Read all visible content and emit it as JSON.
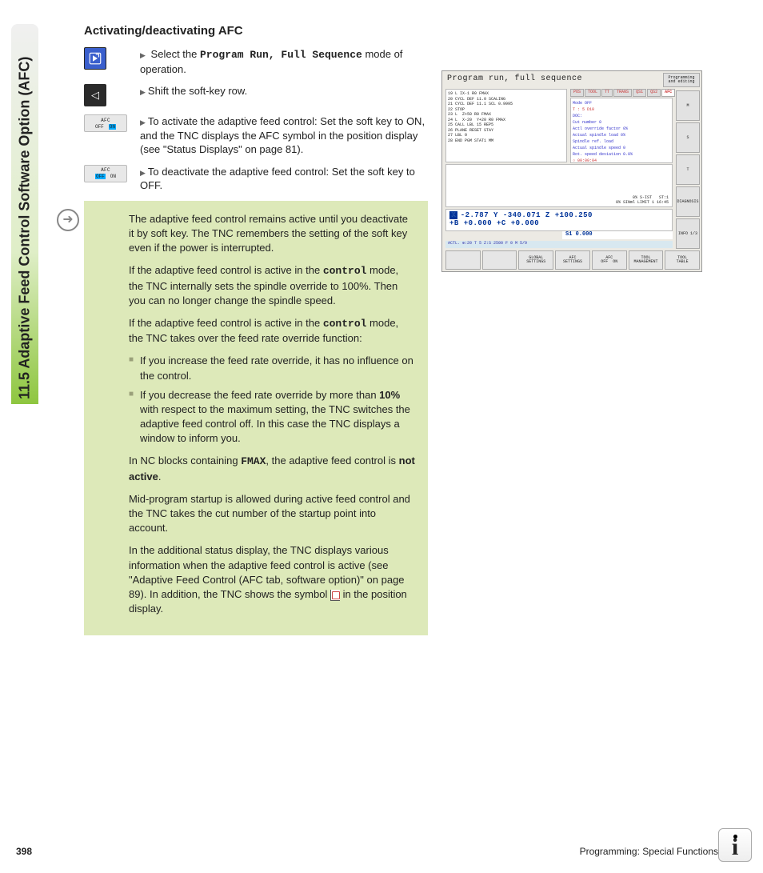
{
  "sidebar": {
    "label": "11.5 Adaptive Feed Control Software Option (AFC)"
  },
  "heading": "Activating/deactivating AFC",
  "steps": {
    "s1a": "Select the ",
    "s1_mono": "Program Run, Full Sequence",
    "s1b": " mode of operation.",
    "s2": "Shift the soft-key row.",
    "s3": "To activate the adaptive feed control: Set the soft key to ON, and the TNC displays the AFC symbol in the position display (see \"Status Displays\" on page 81).",
    "s4": "To deactivate the adaptive feed control: Set the soft key to OFF."
  },
  "softkey": {
    "label": "AFC",
    "off": "OFF",
    "on": "ON"
  },
  "note": {
    "p1": "The adaptive feed control remains active until you deactivate it by soft key. The TNC remembers the setting of the soft key even if the power is interrupted.",
    "p2a": "If the adaptive feed control is active in the ",
    "p2_mono": "control",
    "p2b": " mode, the TNC internally sets the spindle override to 100%. Then you can no longer change the spindle speed.",
    "p3a": "If the adaptive feed control is active in the ",
    "p3_mono": "control",
    "p3b": " mode, the TNC takes over the feed rate override function:",
    "b1": "If you increase the feed rate override, it has no influence on the control.",
    "b2a": "If you decrease the feed rate override by more than ",
    "b2_bold": "10%",
    "b2b": " with respect to the maximum setting, the TNC switches the adaptive feed control off. In this case the TNC displays a window to inform you.",
    "p4a": "In NC blocks containing ",
    "p4_mono": "FMAX",
    "p4b": ", the adaptive feed control is ",
    "p4_bold": "not active",
    "p4c": ".",
    "p5": "Mid-program startup is allowed during active feed control and the TNC takes the cut number of the startup point into account.",
    "p6": "In the additional status display, the TNC displays various information when the adaptive feed control is active (see \"Adaptive Feed Control (AFC tab, software option)\" on page 89). In addition, the TNC shows the symbol ",
    "p6b": " in the position display."
  },
  "screenshot": {
    "title": "Program run, full sequence",
    "topright": "Programming and editing",
    "program": "19 L IX-1 R0 FMAX\n20 CYCL DEF 11.0 SCALING\n21 CYCL DEF 11.1 SCL 0.9995\n22 STOP\n23 L  Z+50 R0 FMAX\n24 L  X-20  Y+20 R0 FMAX\n25 CALL LBL 15 REP5\n26 PLANE RESET STAY\n27 LBL 0\n28 END PGM STAT1 MM",
    "tabs": [
      "POS",
      "TOOL",
      "TT",
      "TRANS",
      "QS1",
      "QS2",
      "AFC"
    ],
    "status": {
      "mode": "Mode OFF",
      "tdoc": "T : 5          D10",
      "doc": "DOC:",
      "cut": "Cut number 0",
      "actl_ovr": "Actl override factor   0%",
      "spindle_load": "Actual spindle load   0%",
      "spindle_ref": "Spindle ref. load",
      "spindle_speed": "Actual spindle speed 0",
      "rot_dev": "Rot. speed deviation 0.0%",
      "time": "○ 00:00:04"
    },
    "graph_lower": "0% S-IST   ST:1\n0% SINml LIMIT 1 16:45",
    "pos": {
      "line1": "X   -2.787  Y  -340.071  Z  +100.250",
      "line2": "+B   +0.000 +C   +0.000"
    },
    "spindle": "S1  0.000",
    "actl": "ACTL.      ⊕:20    T 5    Z:S 2500    F 0    M 5/9",
    "bottomkeys": [
      "",
      "",
      "GLOBAL\nSETTINGS",
      "AFC\nSETTINGS",
      "AFC\nOFF  ON",
      "TOOL\nMANAGEMENT",
      "TOOL\nTABLE"
    ],
    "rightbtns": [
      "M",
      "S",
      "T",
      "DIAGNOSIS",
      "INFO 1/3"
    ]
  },
  "footer": {
    "page": "398",
    "chapter": "Programming: Special Functions"
  },
  "info_badge": "i"
}
